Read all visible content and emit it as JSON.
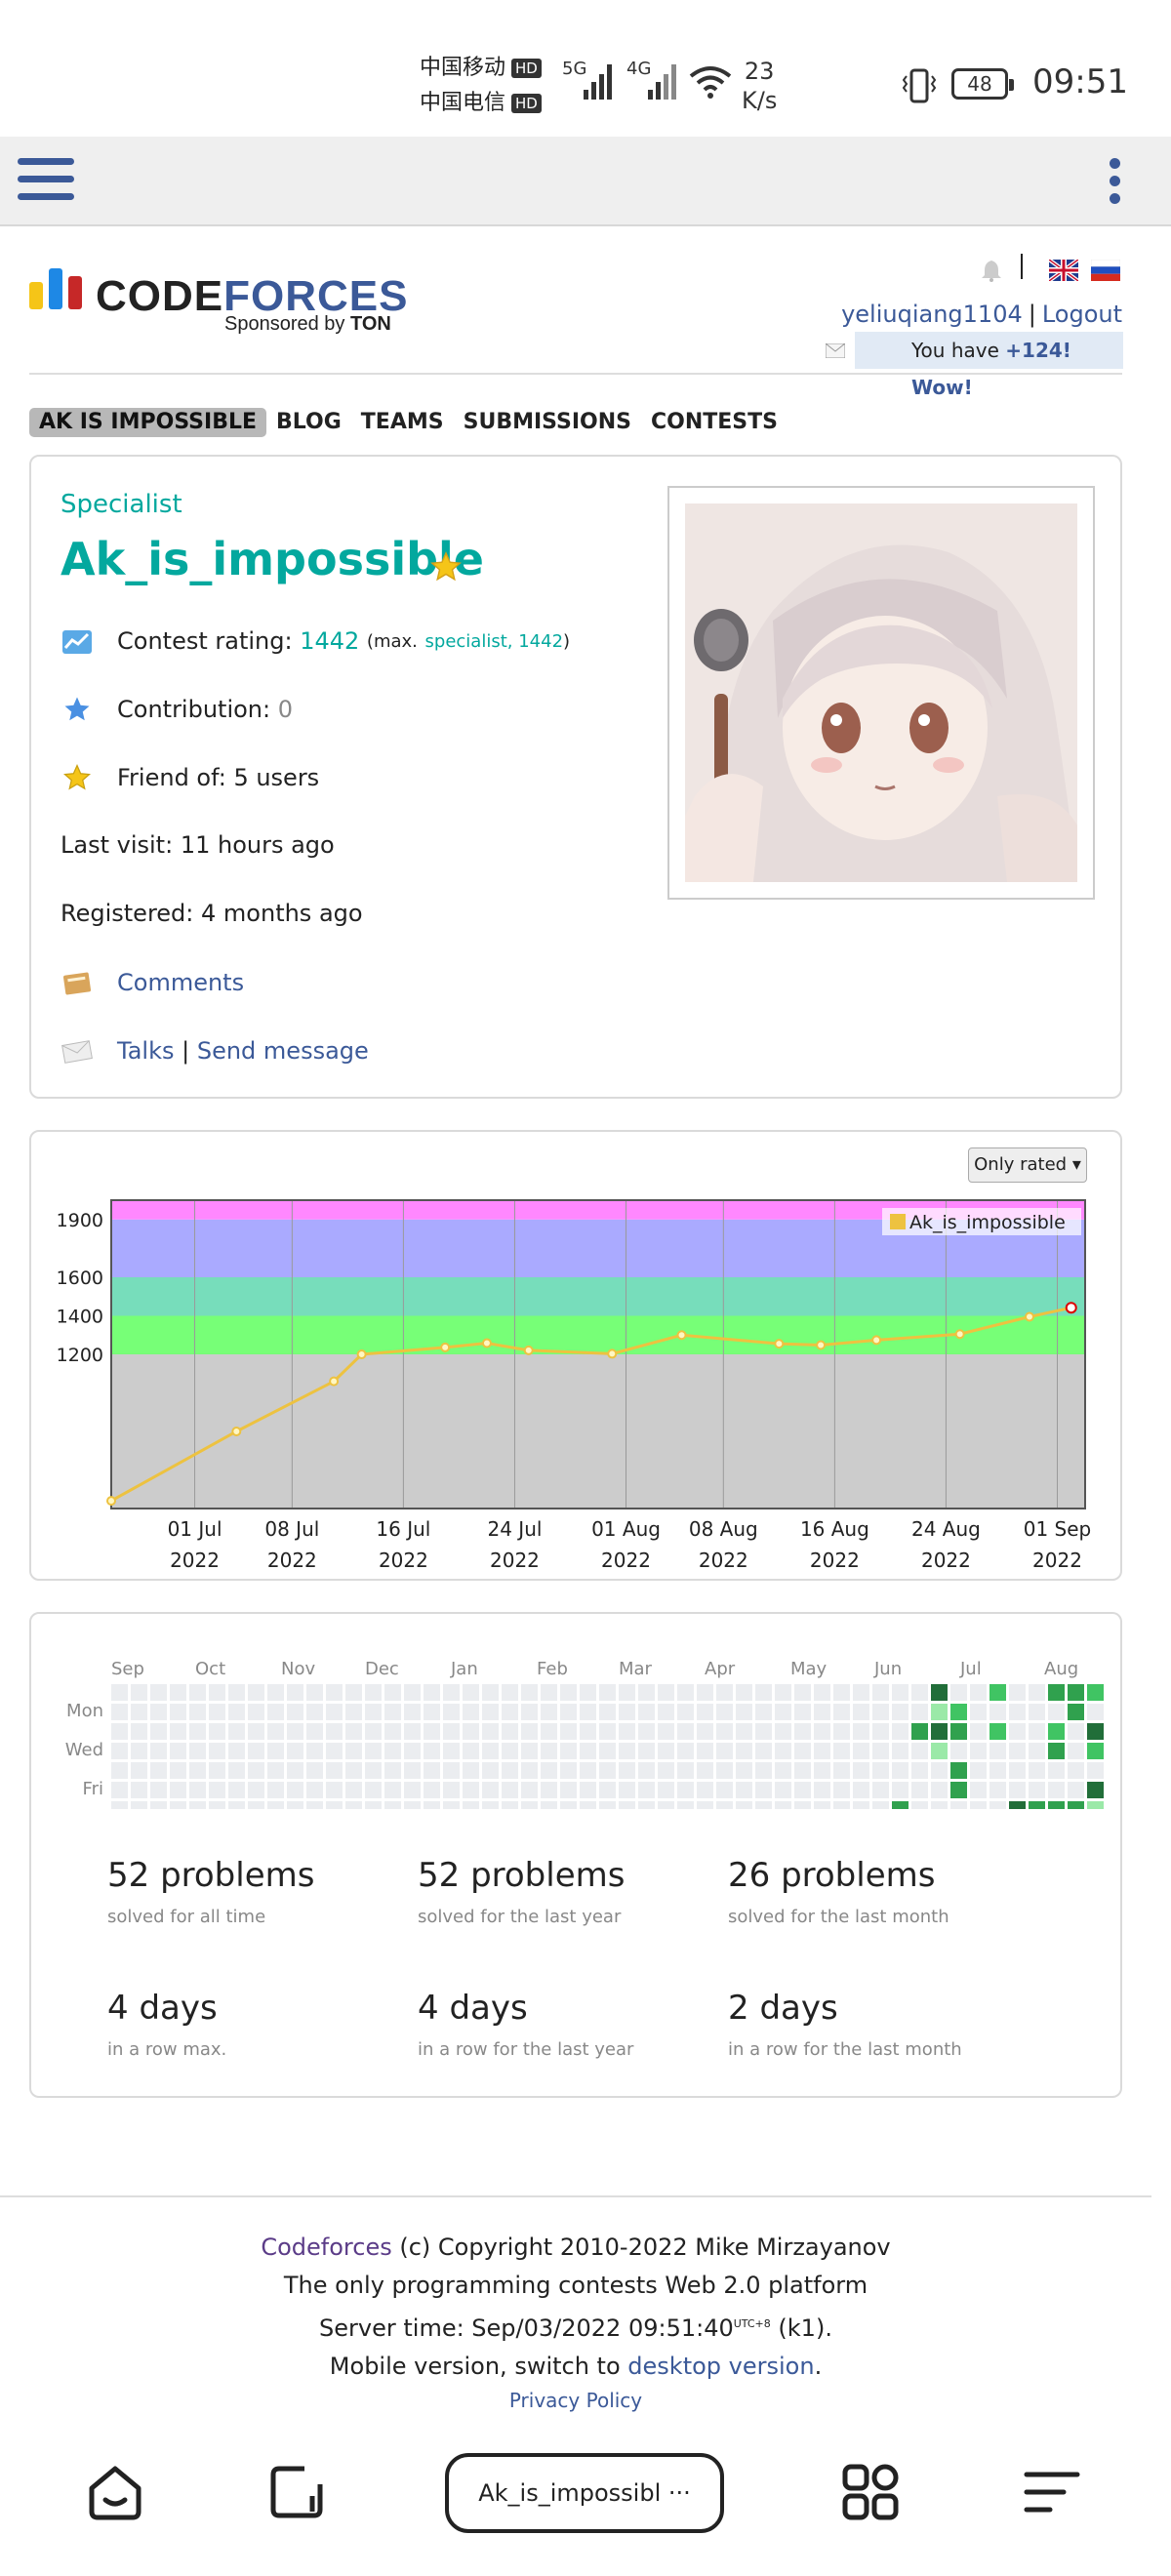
{
  "status_bar": {
    "carrier1": "中国移动",
    "carrier2": "中国电信",
    "hd_label": "HD",
    "net1": "5G",
    "net2": "4G",
    "speed_value": "23",
    "speed_unit": "K/s",
    "battery": "48",
    "time": "09:51"
  },
  "header": {
    "logo_part1": "CODE",
    "logo_part2": "FORCES",
    "sponsor_prefix": "Sponsored by",
    "sponsor_name": "TON",
    "username": "yeliuqiang1104",
    "separator": "|",
    "logout": "Logout",
    "notif_prefix": "You have",
    "notif_count": "+124!",
    "notif_suffix": "Wow!"
  },
  "nav": {
    "items": [
      "AK IS IMPOSSIBLE",
      "BLOG",
      "TEAMS",
      "SUBMISSIONS",
      "CONTESTS"
    ]
  },
  "profile": {
    "rank": "Specialist",
    "handle": "Ak_is_impossible",
    "rating_label": "Contest rating:",
    "rating_value": "1442",
    "max_open": "(max.",
    "max_rank": "specialist, 1442",
    "max_close": ")",
    "contribution_label": "Contribution:",
    "contribution_value": "0",
    "friend_label": "Friend of:",
    "friend_value": "5 users",
    "last_visit_label": "Last visit:",
    "last_visit_value": "11 hours ago",
    "registered_label": "Registered:",
    "registered_value": "4 months ago",
    "comments": "Comments",
    "talks": "Talks",
    "send_message": "Send message",
    "separator": "|"
  },
  "chart_controls": {
    "only_rated": "Only rated"
  },
  "chart_data": {
    "type": "line",
    "title": "",
    "series": [
      {
        "name": "Ak_is_impossible",
        "x": [
          "2022-06-25",
          "2022-07-04",
          "2022-07-11",
          "2022-07-13",
          "2022-07-19",
          "2022-07-22",
          "2022-07-25",
          "2022-07-31",
          "2022-08-05",
          "2022-08-12",
          "2022-08-15",
          "2022-08-19",
          "2022-08-25",
          "2022-08-30",
          "2022-09-02"
        ],
        "values": [
          440,
          800,
          1060,
          1200,
          1236,
          1258,
          1221,
          1203,
          1300,
          1255,
          1248,
          1274,
          1305,
          1395,
          1442
        ]
      }
    ],
    "x_ticks": [
      {
        "date": "2022-07-01",
        "line1": "01 Jul",
        "line2": "2022"
      },
      {
        "date": "2022-07-08",
        "line1": "08 Jul",
        "line2": "2022"
      },
      {
        "date": "2022-07-16",
        "line1": "16 Jul",
        "line2": "2022"
      },
      {
        "date": "2022-07-24",
        "line1": "24 Jul",
        "line2": "2022"
      },
      {
        "date": "2022-08-01",
        "line1": "01 Aug",
        "line2": "2022"
      },
      {
        "date": "2022-08-08",
        "line1": "08 Aug",
        "line2": "2022"
      },
      {
        "date": "2022-08-16",
        "line1": "16 Aug",
        "line2": "2022"
      },
      {
        "date": "2022-08-24",
        "line1": "24 Aug",
        "line2": "2022"
      },
      {
        "date": "2022-09-01",
        "line1": "01 Sep",
        "line2": "2022"
      }
    ],
    "y_ticks": [
      1200,
      1400,
      1600,
      1900
    ],
    "ylim": [
      400,
      2000
    ],
    "xlim": [
      "2022-06-25",
      "2022-09-03"
    ],
    "bands": [
      {
        "from": 400,
        "to": 1200,
        "color": "#cccccc"
      },
      {
        "from": 1200,
        "to": 1400,
        "color": "#77ff77"
      },
      {
        "from": 1400,
        "to": 1600,
        "color": "#77ddbb"
      },
      {
        "from": 1600,
        "to": 1900,
        "color": "#aaaaff"
      },
      {
        "from": 1900,
        "to": 2000,
        "color": "#ff88ff"
      }
    ],
    "line_color": "#edc240",
    "grid": true,
    "legend_position": "top-right"
  },
  "activity": {
    "months": [
      "Sep",
      "Oct",
      "Nov",
      "Dec",
      "Jan",
      "Feb",
      "Mar",
      "Apr",
      "May",
      "Jun",
      "Jul",
      "Aug"
    ],
    "days": [
      "Mon",
      "Wed",
      "Fri"
    ],
    "colors": {
      "empty": "#ebedf0",
      "l1": "#9be9a8",
      "l2": "#40c463",
      "l3": "#30a14e",
      "l4": "#216e39"
    },
    "active_cells": [
      {
        "week": 40,
        "day": 6,
        "level": 3
      },
      {
        "week": 41,
        "day": 2,
        "level": 3
      },
      {
        "week": 42,
        "day": 0,
        "level": 4
      },
      {
        "week": 42,
        "day": 1,
        "level": 1
      },
      {
        "week": 42,
        "day": 2,
        "level": 4
      },
      {
        "week": 42,
        "day": 3,
        "level": 1
      },
      {
        "week": 43,
        "day": 1,
        "level": 2
      },
      {
        "week": 43,
        "day": 2,
        "level": 3
      },
      {
        "week": 43,
        "day": 4,
        "level": 3
      },
      {
        "week": 43,
        "day": 5,
        "level": 3
      },
      {
        "week": 45,
        "day": 0,
        "level": 2
      },
      {
        "week": 45,
        "day": 2,
        "level": 2
      },
      {
        "week": 46,
        "day": 6,
        "level": 4
      },
      {
        "week": 47,
        "day": 6,
        "level": 3
      },
      {
        "week": 48,
        "day": 0,
        "level": 3
      },
      {
        "week": 48,
        "day": 2,
        "level": 2
      },
      {
        "week": 48,
        "day": 3,
        "level": 3
      },
      {
        "week": 48,
        "day": 6,
        "level": 3
      },
      {
        "week": 49,
        "day": 0,
        "level": 3
      },
      {
        "week": 49,
        "day": 1,
        "level": 3
      },
      {
        "week": 49,
        "day": 6,
        "level": 3
      },
      {
        "week": 50,
        "day": 0,
        "level": 2
      },
      {
        "week": 50,
        "day": 2,
        "level": 4
      },
      {
        "week": 50,
        "day": 3,
        "level": 2
      },
      {
        "week": 50,
        "day": 5,
        "level": 4
      },
      {
        "week": 50,
        "day": 6,
        "level": 1
      }
    ],
    "stats": [
      {
        "big": "52 problems",
        "small": "solved for all time"
      },
      {
        "big": "52 problems",
        "small": "solved for the last year"
      },
      {
        "big": "26 problems",
        "small": "solved for the last month"
      },
      {
        "big": "4 days",
        "small": "in a row max."
      },
      {
        "big": "4 days",
        "small": "in a row for the last year"
      },
      {
        "big": "2 days",
        "small": "in a row for the last month"
      }
    ]
  },
  "footer": {
    "codeforces": "Codeforces",
    "copyright": "(c) Copyright 2010-2022 Mike Mirzayanov",
    "tagline": "The only programming contests Web 2.0 platform",
    "server_time_prefix": "Server time: Sep/03/2022 09:51:40",
    "tz": "UTC+8",
    "server_time_suffix": "(k1).",
    "mobile_prefix": "Mobile version, switch to",
    "desktop_link": "desktop version",
    "mobile_suffix": ".",
    "privacy": "Privacy Policy"
  },
  "bottom_nav": {
    "tab_title": "Ak_is_impossibl ···"
  }
}
